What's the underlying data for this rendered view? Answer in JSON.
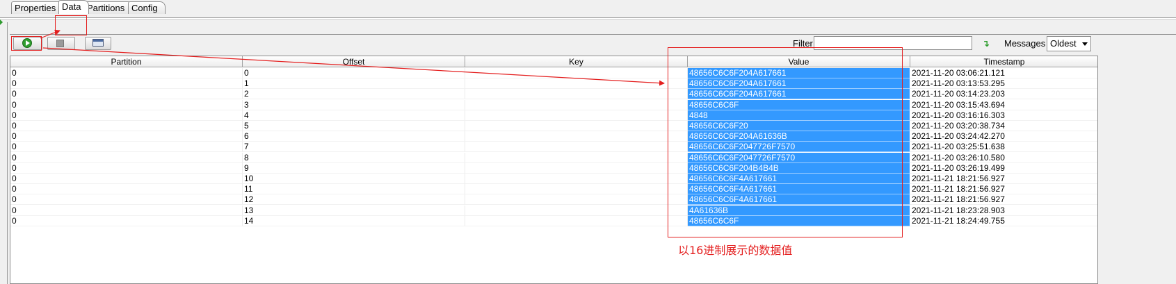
{
  "tabs": [
    {
      "label": "Properties",
      "active": false
    },
    {
      "label": "Data",
      "active": true
    },
    {
      "label": "Partitions",
      "active": false
    },
    {
      "label": "Config",
      "active": false
    }
  ],
  "toolbar": {
    "start_icon": "play-icon",
    "stop_icon": "stop-icon",
    "view_icon": "window-icon"
  },
  "filter": {
    "label": "Filter",
    "value": "",
    "clear_icon": "filter-apply-icon"
  },
  "messages": {
    "label": "Messages",
    "selected": "Oldest"
  },
  "table": {
    "columns": [
      "Partition",
      "Offset",
      "Key",
      "Value",
      "Timestamp"
    ],
    "rows": [
      {
        "partition": "0",
        "offset": "0",
        "key": "",
        "value": "48656C6C6F204A617661",
        "timestamp": "2021-11-20 03:06:21.121"
      },
      {
        "partition": "0",
        "offset": "1",
        "key": "",
        "value": "48656C6C6F204A617661",
        "timestamp": "2021-11-20 03:13:53.295"
      },
      {
        "partition": "0",
        "offset": "2",
        "key": "",
        "value": "48656C6C6F204A617661",
        "timestamp": "2021-11-20 03:14:23.203"
      },
      {
        "partition": "0",
        "offset": "3",
        "key": "",
        "value": "48656C6C6F",
        "timestamp": "2021-11-20 03:15:43.694"
      },
      {
        "partition": "0",
        "offset": "4",
        "key": "",
        "value": "4848",
        "timestamp": "2021-11-20 03:16:16.303"
      },
      {
        "partition": "0",
        "offset": "5",
        "key": "",
        "value": "48656C6C6F20",
        "timestamp": "2021-11-20 03:20:38.734"
      },
      {
        "partition": "0",
        "offset": "6",
        "key": "",
        "value": "48656C6C6F204A61636B",
        "timestamp": "2021-11-20 03:24:42.270"
      },
      {
        "partition": "0",
        "offset": "7",
        "key": "",
        "value": "48656C6C6F2047726F7570",
        "timestamp": "2021-11-20 03:25:51.638"
      },
      {
        "partition": "0",
        "offset": "8",
        "key": "",
        "value": "48656C6C6F2047726F7570",
        "timestamp": "2021-11-20 03:26:10.580"
      },
      {
        "partition": "0",
        "offset": "9",
        "key": "",
        "value": "48656C6C6F204B4B4B",
        "timestamp": "2021-11-20 03:26:19.499"
      },
      {
        "partition": "0",
        "offset": "10",
        "key": "",
        "value": "48656C6C6F4A617661",
        "timestamp": "2021-11-21 18:21:56.927"
      },
      {
        "partition": "0",
        "offset": "11",
        "key": "",
        "value": "48656C6C6F4A617661",
        "timestamp": "2021-11-21 18:21:56.927"
      },
      {
        "partition": "0",
        "offset": "12",
        "key": "",
        "value": "48656C6C6F4A617661",
        "timestamp": "2021-11-21 18:21:56.927"
      },
      {
        "partition": "0",
        "offset": "13",
        "key": "",
        "value": "4A61636B",
        "timestamp": "2021-11-21 18:23:28.903"
      },
      {
        "partition": "0",
        "offset": "14",
        "key": "",
        "value": "48656C6C6F",
        "timestamp": "2021-11-21 18:24:49.755"
      }
    ]
  },
  "annotation": {
    "text": "以16进制展示的数据值",
    "color": "#e41e1e"
  },
  "colors": {
    "selection": "#3399ff",
    "annotation_red": "#e41e1e",
    "start_green": "#2f9e2f"
  }
}
